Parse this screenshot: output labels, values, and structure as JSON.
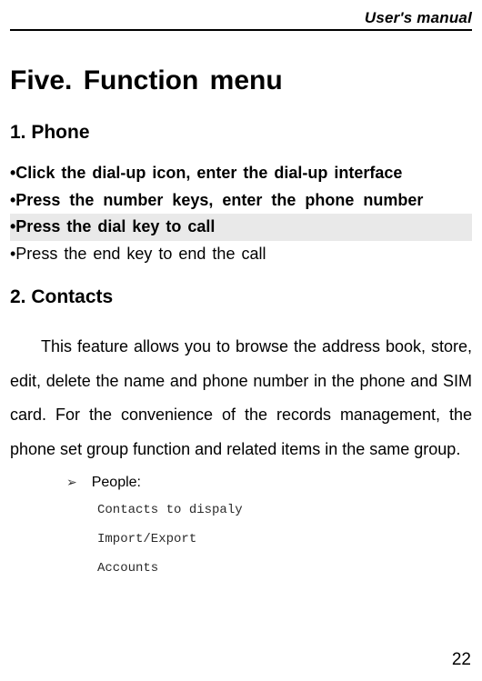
{
  "header": {
    "title": "User's manual"
  },
  "main": {
    "title": "Five.  Function  menu",
    "section1": {
      "heading": "1.  Phone",
      "bullets": [
        "•Click the dial-up icon, enter the dial-up interface",
        "•Press  the  number  keys, enter  the  phone  number",
        "•Press  the dial  key to call",
        "•Press the end  key to end  the  call"
      ]
    },
    "section2": {
      "heading": "2.  Contacts",
      "paragraph": "This feature allows you to browse the address book, store, edit, delete the name and phone number in the phone and SIM card. For the convenience of the records management, the phone set group function and related items in the same group.",
      "list_marker": "➢",
      "list_label": "People:",
      "subitems": [
        "Contacts to dispaly",
        "Import/Export",
        "Accounts"
      ]
    }
  },
  "footer": {
    "page": "22"
  }
}
